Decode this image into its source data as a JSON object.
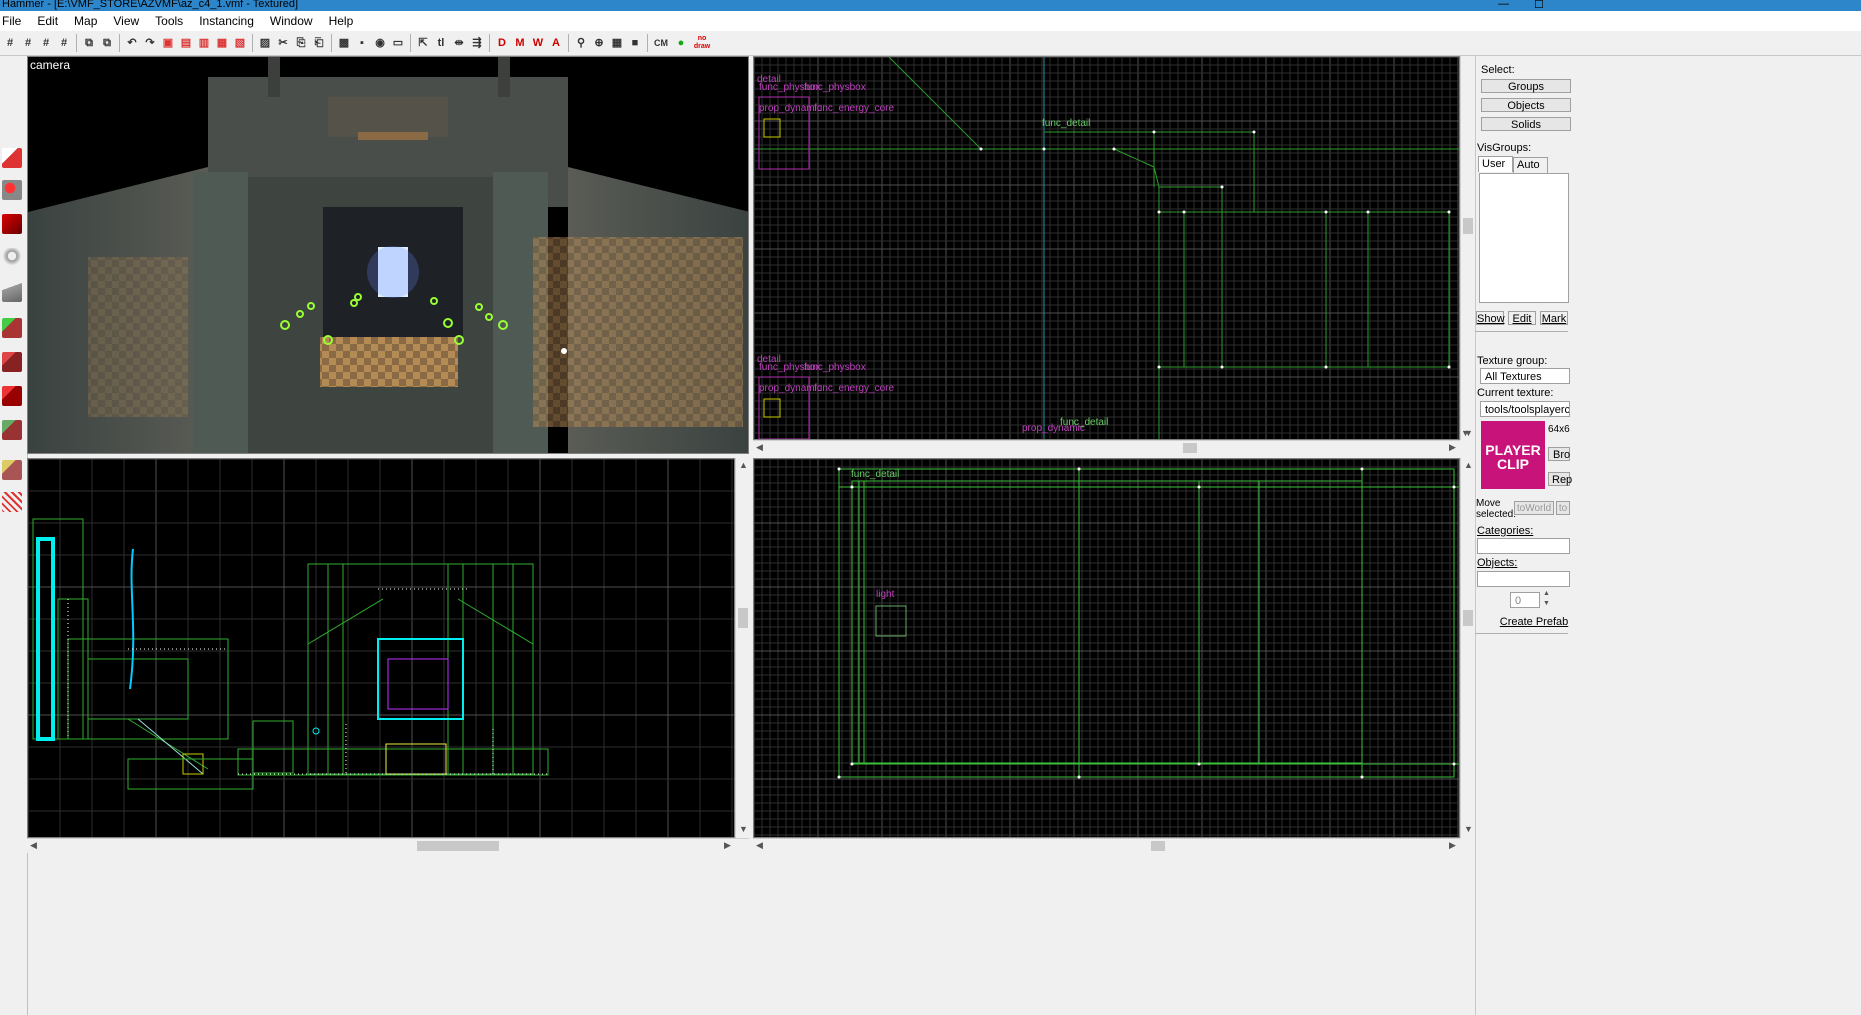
{
  "window": {
    "title": "Hammer - [E:\\VMF_STORE\\AZVMF\\az_c4_1.vmf - Textured]",
    "controls": [
      "—",
      "☐"
    ]
  },
  "menubar": [
    "File",
    "Edit",
    "Map",
    "View",
    "Tools",
    "Instancing",
    "Window",
    "Help"
  ],
  "toolbar": {
    "buttons": [
      "#",
      "#",
      "#",
      "#",
      "⧉",
      "⧉",
      "↶",
      "↷",
      "▣",
      "▤",
      "▥",
      "▦",
      "▧",
      "▨",
      "✂",
      "⎘",
      "⎗",
      "▩",
      "▪",
      "◉",
      "▭",
      "⇱",
      "tl",
      "⇹",
      "⇶",
      "D",
      "M",
      "W",
      "A",
      "⚲",
      "⊕",
      "▦",
      "■",
      "CM",
      "●",
      "no draw"
    ]
  },
  "viewports": {
    "camera": {
      "label": "camera"
    },
    "top_right": {
      "labels": [
        "detail",
        "func_physbox",
        "func_physbox",
        "prop_dynamic",
        "func_energy_core",
        "func_detail",
        "detail",
        "func_physbox",
        "func_physbox",
        "prop_dynamic",
        "func_energy_core",
        "prop_dynamic",
        "func_detail"
      ]
    },
    "bottom_right": {
      "labels": [
        "func_detail",
        "light"
      ]
    }
  },
  "right_panel": {
    "select_label": "Select:",
    "select_buttons": [
      "Groups",
      "Objects",
      "Solids"
    ],
    "visgroups_label": "VisGroups:",
    "visgroup_tabs": [
      "User",
      "Auto"
    ],
    "visgroup_buttons": [
      "Show",
      "Edit",
      "Mark"
    ],
    "texture_group_label": "Texture group:",
    "texture_group_value": "All Textures",
    "current_texture_label": "Current texture:",
    "current_texture_value": "tools/toolsplayerclip",
    "texture_preview_text": "PLAYER CLIP",
    "texture_size": "64x6",
    "browse_button": "Bro",
    "replace_button": "Rep",
    "move_selected_label": "Move selected:",
    "to_world_button": "toWorld",
    "to_button": "to",
    "categories_label": "Categories:",
    "objects_label": "Objects:",
    "spinner_value": "0",
    "create_prefab_button": "Create Prefab"
  }
}
